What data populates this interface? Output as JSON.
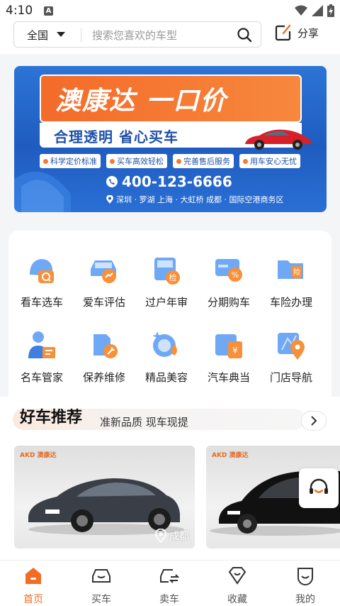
{
  "status_bar": {
    "time": "4:10",
    "notification_letter": "A"
  },
  "header": {
    "city": "全国",
    "search_placeholder": "搜索您喜欢的车型",
    "share_label": "分享"
  },
  "banner": {
    "headline": "澳康达 一口价",
    "subline": "合理透明 省心买车",
    "tags": [
      "科学定价标准",
      "买车高效轻松",
      "完善售后服务",
      "用车安心无忧"
    ],
    "phone": "400-123-6666",
    "address": "深圳 · 罗湖  上海 · 大虹桥  成都 · 国际空港商务区"
  },
  "services": [
    {
      "label": "看车选车",
      "icon": "car-search-icon"
    },
    {
      "label": "爱车评估",
      "icon": "car-evaluate-icon"
    },
    {
      "label": "过户年审",
      "icon": "transfer-inspect-icon"
    },
    {
      "label": "分期购车",
      "icon": "installment-icon"
    },
    {
      "label": "车险办理",
      "icon": "insurance-icon"
    },
    {
      "label": "名车管家",
      "icon": "butler-icon"
    },
    {
      "label": "保养维修",
      "icon": "maintenance-icon"
    },
    {
      "label": "精品美容",
      "icon": "beauty-icon"
    },
    {
      "label": "汽车典当",
      "icon": "pawn-icon"
    },
    {
      "label": "门店导航",
      "icon": "store-nav-icon"
    }
  ],
  "recommend": {
    "title": "好车推荐",
    "subtitle": "准新品质 现车现提",
    "cards": [
      {
        "brand": "AKD 澳康达",
        "location": "成都"
      },
      {
        "brand": "AKD 澳康达",
        "location": ""
      }
    ]
  },
  "bottom_nav": [
    {
      "label": "首页",
      "active": true
    },
    {
      "label": "买车",
      "active": false
    },
    {
      "label": "卖车",
      "active": false
    },
    {
      "label": "收藏",
      "active": false
    },
    {
      "label": "我的",
      "active": false
    }
  ],
  "colors": {
    "accent": "#f26d21",
    "banner_blue": "#1f5cc0"
  }
}
